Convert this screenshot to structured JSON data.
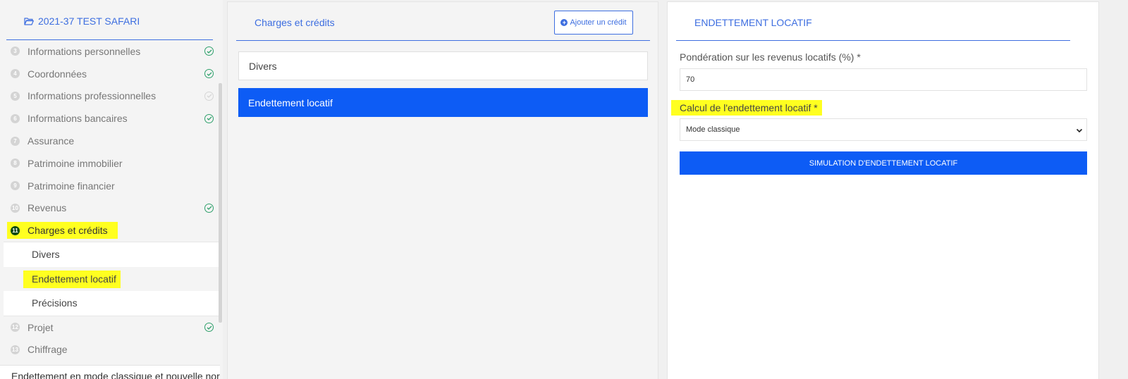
{
  "sidebar": {
    "folder_label": "2021-37 TEST SAFARI",
    "steps": [
      {
        "num": "3",
        "label": "Informations personnelles",
        "status": "done"
      },
      {
        "num": "4",
        "label": "Coordonnées",
        "status": "done"
      },
      {
        "num": "5",
        "label": "Informations professionnelles",
        "status": "pending"
      },
      {
        "num": "6",
        "label": "Informations bancaires",
        "status": "done"
      },
      {
        "num": "7",
        "label": "Assurance",
        "status": "none"
      },
      {
        "num": "8",
        "label": "Patrimoine immobilier",
        "status": "none"
      },
      {
        "num": "9",
        "label": "Patrimoine financier",
        "status": "none"
      },
      {
        "num": "10",
        "label": "Revenus",
        "status": "done"
      },
      {
        "num": "11",
        "label": "Charges et crédits",
        "status": "active"
      },
      {
        "num": "12",
        "label": "Projet",
        "status": "done"
      },
      {
        "num": "13",
        "label": "Chiffrage",
        "status": "none"
      }
    ],
    "substeps": [
      "Divers",
      "Endettement locatif",
      "Précisions"
    ],
    "footer_text": "Endettement en mode classique et nouvelle norme"
  },
  "middle": {
    "title": "Charges et crédits",
    "add_button_label": "Ajouter un crédit",
    "items": [
      "Divers",
      "Endettement locatif"
    ]
  },
  "right": {
    "title": "ENDETTEMENT LOCATIF",
    "field1_label": "Pondération sur les revenus locatifs (%) *",
    "field1_value": "70",
    "field2_label": "Calcul de l'endettement locatif *",
    "field2_value": "Mode classique",
    "simulate_button_label": "SIMULATION D'ENDETTEMENT LOCATIF"
  },
  "colors": {
    "accent": "#3d6ee0",
    "primary_button": "#0d5cf5",
    "highlight": "#ffff20",
    "check": "#2ea06b"
  }
}
